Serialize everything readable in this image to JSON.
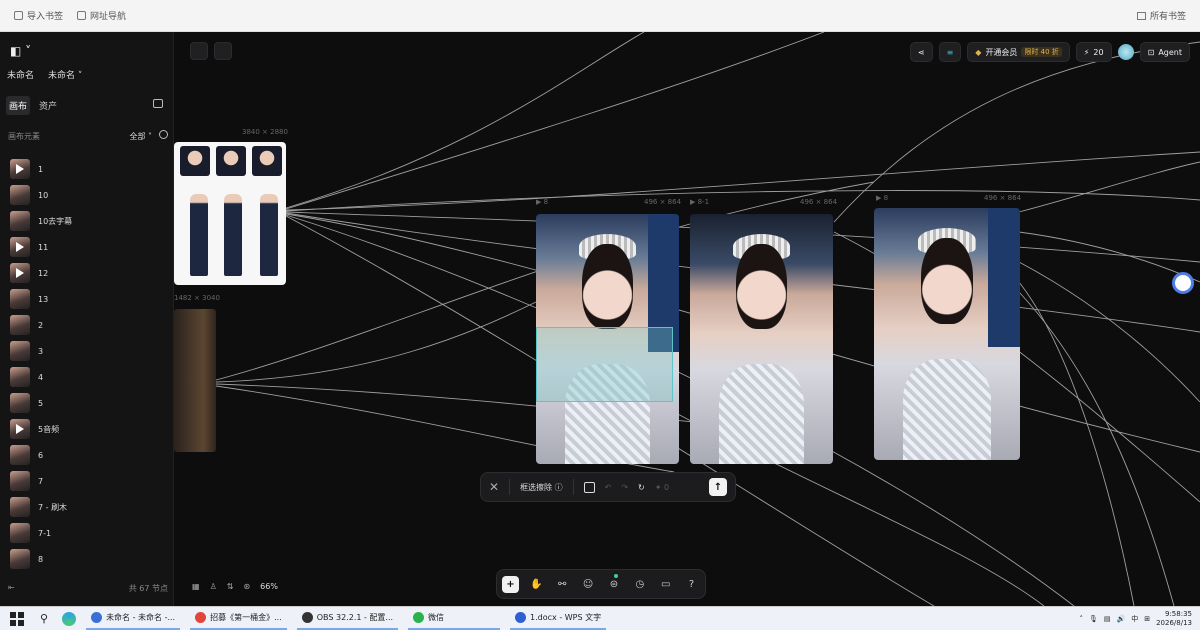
{
  "browser": {
    "bookmarks": [
      "导入书签",
      "网址导航"
    ],
    "all_bookmarks": "所有书签"
  },
  "sidebar": {
    "project_names": [
      "未命名",
      "未命名"
    ],
    "tabs": [
      {
        "label": "画布",
        "active": true
      },
      {
        "label": "资产",
        "active": false
      }
    ],
    "section_title": "画布元素",
    "filter_label": "全部",
    "items": [
      {
        "label": "1",
        "video": true
      },
      {
        "label": "10",
        "video": false
      },
      {
        "label": "10去字幕",
        "video": false
      },
      {
        "label": "11",
        "video": true
      },
      {
        "label": "12",
        "video": true
      },
      {
        "label": "13",
        "video": false
      },
      {
        "label": "2",
        "video": false
      },
      {
        "label": "3",
        "video": false
      },
      {
        "label": "4",
        "video": false
      },
      {
        "label": "5",
        "video": false
      },
      {
        "label": "5音频",
        "video": true
      },
      {
        "label": "6",
        "video": false
      },
      {
        "label": "7",
        "video": false
      },
      {
        "label": "7 - 刷木",
        "video": false
      },
      {
        "label": "7-1",
        "video": false
      },
      {
        "label": "8",
        "video": false
      }
    ],
    "total": "共 67 节点"
  },
  "canvas": {
    "top_right": {
      "membership": "开通会员",
      "membership_tag": "限时 40 折",
      "credits": "20",
      "agent": "Agent"
    },
    "node_labels": {
      "char_sheet": "3840 × 2880",
      "door": "1482 × 3040",
      "img1": "496 × 864",
      "img2": "496 × 864",
      "img3": "496 × 864"
    },
    "float_toolbar": {
      "label": "框选擦除",
      "count": "0"
    },
    "zoom": "66%"
  },
  "taskbar": {
    "apps": [
      {
        "label": "未命名 - 未命名 -...",
        "color": "#3b6fd8"
      },
      {
        "label": "招募《第一桶金》...",
        "color": "#e0463a"
      },
      {
        "label": "OBS 32.2.1 - 配置...",
        "color": "#333333"
      },
      {
        "label": "微信",
        "color": "#2bb24c"
      },
      {
        "label": "1.docx - WPS 文字",
        "color": "#2f5fd1"
      }
    ],
    "ime": "中",
    "time": "9:58:35",
    "date": "2026/8/13"
  },
  "colors": {
    "accent_selection": "#5dc4c9",
    "gold": "#e3b34b",
    "canvas_bg": "#0d0d0e"
  }
}
